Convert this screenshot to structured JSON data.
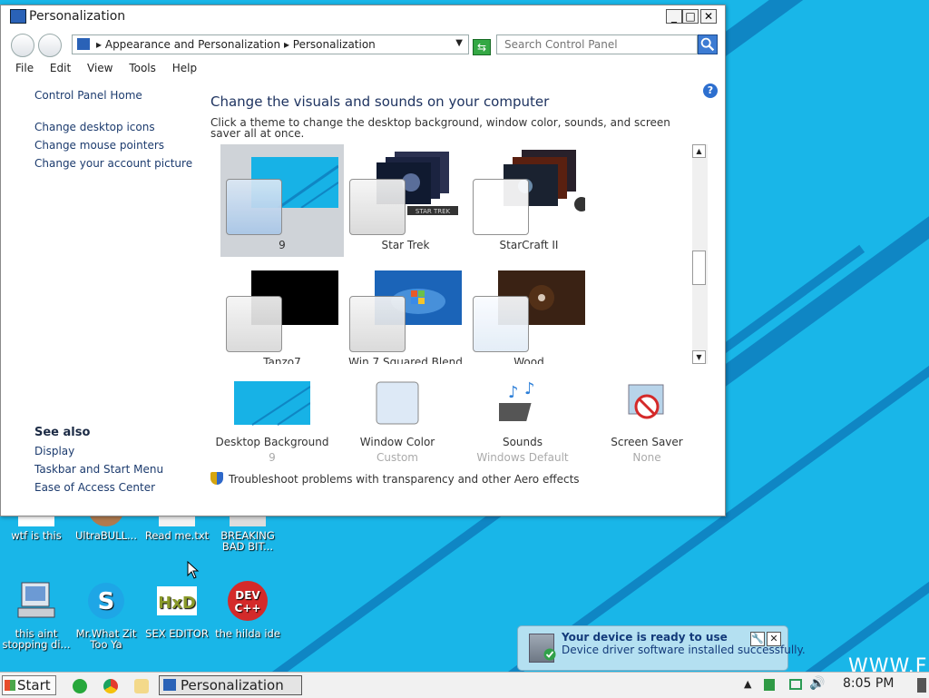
{
  "window": {
    "title": "Personalization",
    "controls": {
      "minimize": "_",
      "maximize": "□",
      "close": "✕"
    },
    "address": {
      "crumb1": "Appearance and Personalization",
      "crumb2": "Personalization",
      "sep": "▸"
    },
    "search_placeholder": "Search Control Panel",
    "menu": [
      "File",
      "Edit",
      "View",
      "Tools",
      "Help"
    ],
    "help_glyph": "?"
  },
  "leftnav": {
    "home": "Control Panel Home",
    "links": [
      "Change desktop icons",
      "Change mouse pointers",
      "Change your account picture"
    ],
    "see_also_title": "See also",
    "see_also": [
      "Display",
      "Taskbar and Start Menu",
      "Ease of Access Center"
    ]
  },
  "main": {
    "heading": "Change the visuals and sounds on your computer",
    "subtext": "Click a theme to change the desktop background, window color, sounds, and screen saver all at once.",
    "themes": [
      {
        "name": "9",
        "selected": true,
        "color": "#17b2e6"
      },
      {
        "name": "Star Trek",
        "selected": false,
        "color": "#1b2340"
      },
      {
        "name": "StarCraft II",
        "selected": false,
        "color": "#1a2230"
      },
      {
        "name": "Tanzo7",
        "selected": false,
        "color": "#000000"
      },
      {
        "name": "Win 7 Squared Blend",
        "selected": false,
        "color": "#1b64b8"
      },
      {
        "name": "Wood",
        "selected": false,
        "color": "#3a2214"
      }
    ],
    "star_trek_badge": "STAR TREK",
    "bottom": [
      {
        "title": "Desktop Background",
        "sub": "9"
      },
      {
        "title": "Window Color",
        "sub": "Custom"
      },
      {
        "title": "Sounds",
        "sub": "Windows Default"
      },
      {
        "title": "Screen Saver",
        "sub": "None"
      }
    ],
    "troubleshoot": "Troubleshoot problems with transparency and other Aero effects"
  },
  "desktop": {
    "icons_row1": [
      "wtf is this",
      "UltraBULL...",
      "Read me.txt",
      "BREAKING BAD BIT..."
    ],
    "icons_row2": [
      "this aint stopping di...",
      "Mr.What Zit Too Ya",
      "SEX EDITOR",
      "the hilda ide"
    ],
    "devcpp_line1": "DEV",
    "devcpp_line2": "C++",
    "hxd_text": "HxD",
    "watermark": "WWW.FE"
  },
  "taskbar": {
    "start": "Start",
    "active_task": "Personalization",
    "clock": "8:05 PM"
  },
  "balloon": {
    "title": "Your device is ready to use",
    "text": "Device driver software installed successfully.",
    "pin": "🔧",
    "close": "✕"
  }
}
